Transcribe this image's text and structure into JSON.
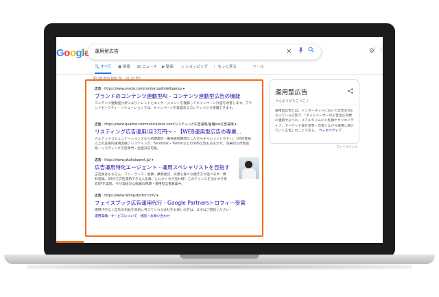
{
  "search": {
    "query": "運用型広告",
    "clear_icon": "close-icon",
    "mic_icon": "microphone-icon",
    "search_icon": "search-icon"
  },
  "logo": {
    "letters": [
      "G",
      "o",
      "o",
      "g",
      "l",
      "e"
    ],
    "colors": [
      "#4285f4",
      "#ea4335",
      "#fbbc05",
      "#4285f4",
      "#34a853",
      "#ea4335"
    ]
  },
  "tabs": [
    {
      "label": "すべて",
      "active": true
    },
    {
      "label": "画像"
    },
    {
      "label": "ニュース"
    },
    {
      "label": "動画"
    },
    {
      "label": "ショッピング"
    },
    {
      "label": "もっと見る"
    },
    {
      "label": "ツール"
    }
  ],
  "stats": "約 38,800,000 件　（0.37 秒）",
  "ads": [
    {
      "label": "広告",
      "url": "https://www.oracle.com/contextual/intelligence",
      "title": "ブランドのコンテンツ連動型AI - コンテンツ連動型広告の機能",
      "desc": "コンテンツ連動型分析によりトレンドとエンゲージメントを理解してキャンペーン計画を改善します。ブランドセーフティ・ソリューションでは、キャンペーンを意図あるコンテンツから保護できます。"
    },
    {
      "label": "広告",
      "url": "https://www.quartet-communications.com/リスティング広告運用/各種sns広告運用",
      "title": "リスティング広告運用/月3万円〜 - 【WEB運用型広告の専業...",
      "desc": "カルテットコミュニケーションズなら初期無料・最低継続期間なしだからチャレンジしやすい。1000者様以上の圧倒的運用実績 / リスティング、Facebook・TwitterなどのSNS広告もおまかせ。効果的な改善提案・リスティング広告専門・全国対応可能。"
    },
    {
      "label": "広告",
      "url": "https://www.akahaiagent.jp/",
      "title": "広告運用特化エージェント - 運用スペシャリストを目指す",
      "desc": "正社員はもちろん、フリーランス・副業・業務委託、派遣と様々な働き方が選べます／無料登録。20代で広告運用できる人急募／とにかく今が売れ時！このチャンスを活かすぞ年収UPを実現。今が高給与な転職の時期・運用担当者募集中。"
    },
    {
      "label": "広告",
      "url": "https://www.listing-doctor.com/",
      "title": "フェイスブック広告運用代行 - Google Partnersトロフィー受賞",
      "desc": "運用代行なく自社の利益を真剣に考えてくれる会社をお探しの方は、まずはご相談ください！",
      "links": "運用実績 · サービスについて · 相談・お問い合わせ"
    }
  ],
  "knowledge_panel": {
    "title": "運用型広告",
    "reading": "うんようがたこうこく",
    "desc": "運用型広告とは、インターネットにおいて近年主流となっている広告で、「ネットユーザーの広告出広目標に連続すように、リアルタイムに入札額やクリエイティブ、ターゲット等を変更・改善しながら運用し続けていく広告」のことである。",
    "link": "ウィキペディア",
    "feedback": "フィードバック"
  },
  "colors": {
    "ad_highlight": "#f26b1d",
    "link": "#1a0dab",
    "accent": "#1a73e8"
  }
}
